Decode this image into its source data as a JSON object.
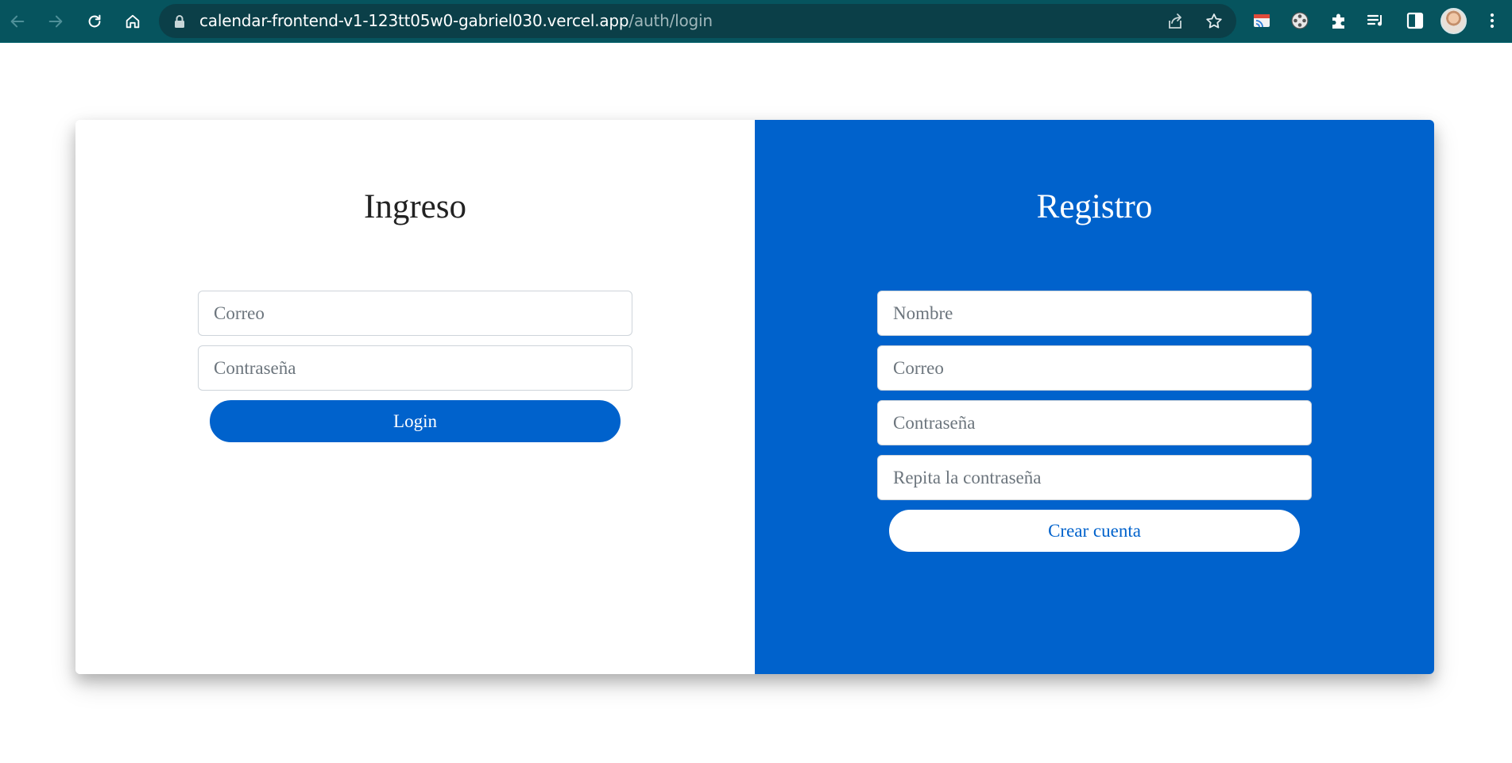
{
  "browser": {
    "url_host": "calendar-frontend-v1-123tt05w0-gabriel030.vercel.app",
    "url_path": "/auth/login",
    "icons": {
      "back": "back-arrow-icon",
      "forward": "forward-arrow-icon",
      "reload": "reload-icon",
      "home": "home-icon",
      "lock": "lock-icon",
      "share": "share-icon",
      "bookmark": "star-icon",
      "extension_1": "cast-icon",
      "extension_2": "film-reel-icon",
      "extensions": "puzzle-icon",
      "media": "playlist-icon",
      "side_panel": "side-panel-icon",
      "menu": "kebab-menu-icon"
    },
    "colors": {
      "toolbar": "#06545e",
      "omnibox": "#0b3f48",
      "url_path": "#9fb6ba"
    }
  },
  "login": {
    "title": "Ingreso",
    "email_placeholder": "Correo",
    "password_placeholder": "Contraseña",
    "submit_label": "Login"
  },
  "register": {
    "title": "Registro",
    "name_placeholder": "Nombre",
    "email_placeholder": "Correo",
    "password_placeholder": "Contraseña",
    "repeat_password_placeholder": "Repita la contraseña",
    "submit_label": "Crear cuenta"
  },
  "colors": {
    "primary": "#0062cc",
    "background": "#ffffff",
    "input_border": "#ced4da"
  }
}
